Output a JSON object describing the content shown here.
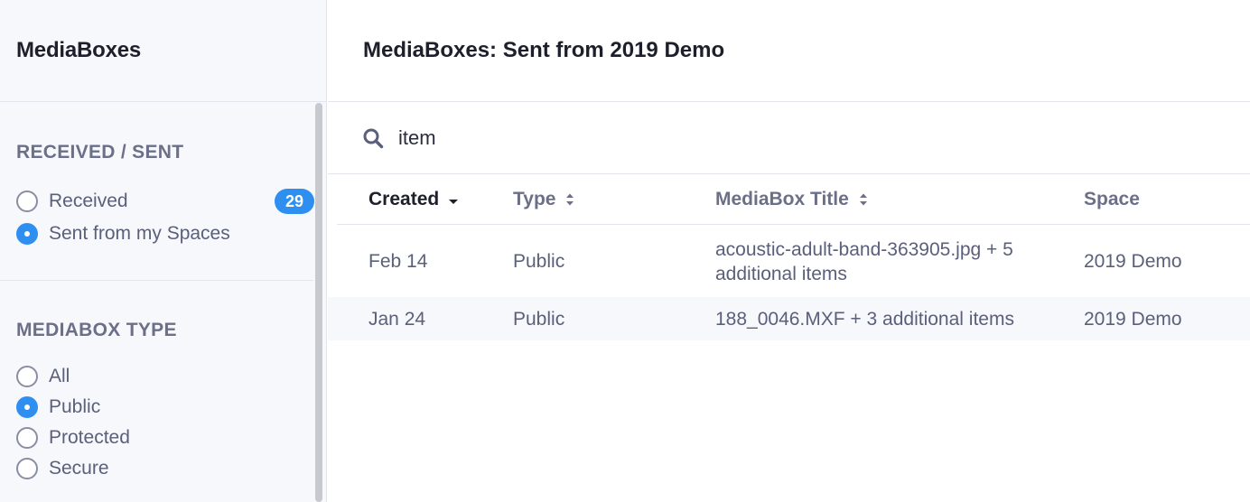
{
  "sidebar": {
    "title": "MediaBoxes",
    "received_sent": {
      "heading": "RECEIVED / SENT",
      "options": [
        {
          "label": "Received",
          "selected": false,
          "count": "29"
        },
        {
          "label": "Sent from my Spaces",
          "selected": true
        }
      ]
    },
    "mediabox_type": {
      "heading": "MEDIABOX TYPE",
      "options": [
        {
          "label": "All",
          "selected": false
        },
        {
          "label": "Public",
          "selected": true
        },
        {
          "label": "Protected",
          "selected": false
        },
        {
          "label": "Secure",
          "selected": false
        }
      ]
    }
  },
  "main": {
    "title": "MediaBoxes: Sent from 2019 Demo",
    "search": {
      "icon": "search-icon",
      "value": "item"
    },
    "table": {
      "columns": [
        {
          "label": "Created",
          "sort": "sort-desc-icon"
        },
        {
          "label": "Type",
          "sort": "sort-icon"
        },
        {
          "label": "MediaBox Title",
          "sort": "sort-icon"
        },
        {
          "label": "Space"
        }
      ],
      "rows": [
        {
          "created": "Feb 14",
          "type": "Public",
          "title": "acoustic-adult-band-363905.jpg + 5 additional items",
          "space": "2019 Demo"
        },
        {
          "created": "Jan 24",
          "type": "Public",
          "title": "188_0046.MXF + 3 additional items",
          "space": "2019 Demo"
        }
      ]
    }
  },
  "colors": {
    "accent": "#2f8ff0",
    "text_dark": "#1d1f2b",
    "text_muted": "#5a5f7a",
    "sidebar_bg": "#f7f8fc"
  }
}
